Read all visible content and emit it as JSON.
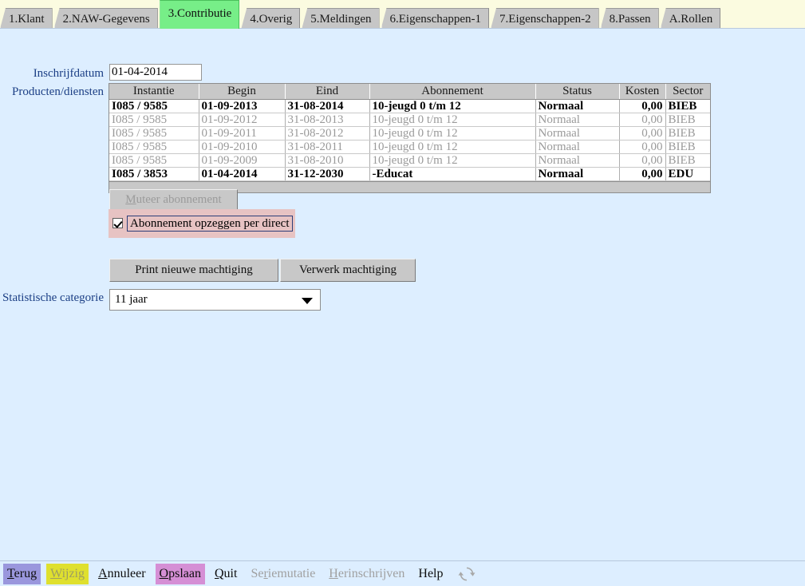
{
  "tabs": [
    {
      "label": "1.Klant",
      "active": false
    },
    {
      "label": "2.NAW-Gegevens",
      "active": false
    },
    {
      "label": "3.Contributie",
      "active": true
    },
    {
      "label": "4.Overig",
      "active": false
    },
    {
      "label": "5.Meldingen",
      "active": false
    },
    {
      "label": "6.Eigenschappen-1",
      "active": false
    },
    {
      "label": "7.Eigenschappen-2",
      "active": false
    },
    {
      "label": "8.Passen",
      "active": false
    },
    {
      "label": "A.Rollen",
      "active": false
    }
  ],
  "form": {
    "inschrijfdatum_label": "Inschrijfdatum",
    "inschrijfdatum_value": "01-04-2014",
    "producten_label": "Producten/diensten",
    "statistische_label": "Statistische categorie",
    "statistische_value": "11 jaar"
  },
  "table": {
    "columns": [
      "Instantie",
      "Begin",
      "Eind",
      "Abonnement",
      "Status",
      "Kosten",
      "Sector"
    ],
    "rows": [
      {
        "state": "active",
        "cells": [
          "I085 / 9585",
          "01-09-2013",
          "31-08-2014",
          "10-jeugd 0 t/m 12",
          "Normaal",
          "0,00",
          "BIEB"
        ]
      },
      {
        "state": "dim",
        "cells": [
          "I085 / 9585",
          "01-09-2012",
          "31-08-2013",
          "10-jeugd 0 t/m 12",
          "Normaal",
          "0,00",
          "BIEB"
        ]
      },
      {
        "state": "dim",
        "cells": [
          "I085 / 9585",
          "01-09-2011",
          "31-08-2012",
          "10-jeugd 0 t/m 12",
          "Normaal",
          "0,00",
          "BIEB"
        ]
      },
      {
        "state": "dim",
        "cells": [
          "I085 / 9585",
          "01-09-2010",
          "31-08-2011",
          "10-jeugd 0 t/m 12",
          "Normaal",
          "0,00",
          "BIEB"
        ]
      },
      {
        "state": "dim",
        "cells": [
          "I085 / 9585",
          "01-09-2009",
          "31-08-2010",
          "10-jeugd 0 t/m 12",
          "Normaal",
          "0,00",
          "BIEB"
        ]
      },
      {
        "state": "active",
        "cells": [
          "I085 / 3853",
          "01-04-2014",
          "31-12-2030",
          "-Educat",
          "Normaal",
          "0,00",
          "EDU"
        ]
      }
    ]
  },
  "buttons": {
    "muteer": {
      "label": "Muteer abonnement",
      "mnemonic": "M",
      "enabled": false
    },
    "print_machtiging": {
      "label": "Print nieuwe machtiging",
      "enabled": true
    },
    "verwerk_machtiging": {
      "label": "Verwerk machtiging",
      "enabled": true
    }
  },
  "checkbox": {
    "label": "Abonnement opzeggen per direct",
    "checked": true
  },
  "toolbar": {
    "items": [
      {
        "label": "Terug",
        "mnemonic": "T",
        "highlight": "#9a97dd",
        "enabled": true
      },
      {
        "label": "Wijzig",
        "mnemonic": "W",
        "highlight": "#dfe02e",
        "enabled": false
      },
      {
        "label": "Annuleer",
        "mnemonic": "A",
        "highlight": "",
        "enabled": true
      },
      {
        "label": "Opslaan",
        "mnemonic": "O",
        "highlight": "#d58fd5",
        "enabled": true
      },
      {
        "label": "Quit",
        "mnemonic": "Q",
        "highlight": "",
        "enabled": true
      },
      {
        "label": "Seriemutatie",
        "mnemonic": "r",
        "highlight": "",
        "enabled": false
      },
      {
        "label": "Herinschrijven",
        "mnemonic": "H",
        "highlight": "",
        "enabled": false
      },
      {
        "label": "Help",
        "mnemonic": "",
        "highlight": "",
        "enabled": true
      }
    ],
    "refresh_icon": "refresh-icon"
  },
  "colors": {
    "background": "#ddeeff",
    "tabbar": "#fbfbe0",
    "active_tab": "#77ee88",
    "label_text": "#1c3f85",
    "checkbox_highlight": "#e7c3c3",
    "control_face": "#c8c8c8"
  }
}
